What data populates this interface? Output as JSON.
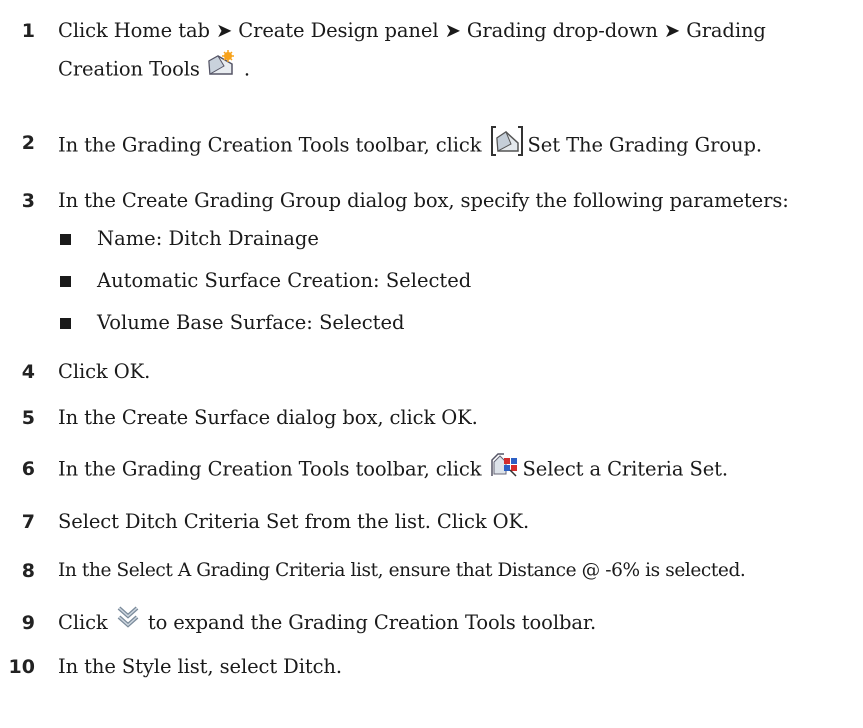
{
  "steps": [
    {
      "number": "1",
      "text_a": "Click Home tab ➤ Create Design panel ➤ Grading drop-down ➤ Grading",
      "text_b": "Creation Tools",
      "text_c": " .",
      "icon": "grading-creation-tools-icon"
    },
    {
      "number": "2",
      "text_a": "In the Grading Creation Tools toolbar, click ",
      "text_b": "Set The Grading Group.",
      "icon": "set-grading-group-icon"
    },
    {
      "number": "3",
      "text_a": "In the Create Grading Group dialog box, specify the following parameters:"
    },
    {
      "number": "4",
      "text_a": "Click OK."
    },
    {
      "number": "5",
      "text_a": "In the Create Surface dialog box, click OK."
    },
    {
      "number": "6",
      "text_a": "In the Grading Creation Tools toolbar, click ",
      "text_b": "Select a Criteria Set.",
      "icon": "select-criteria-set-icon"
    },
    {
      "number": "7",
      "text_a": "Select Ditch Criteria Set from the list. Click OK."
    },
    {
      "number": "8",
      "text_a": "In the Select A Grading Criteria list, ensure that Distance @ -6% is selected."
    },
    {
      "number": "9",
      "text_a": "Click ",
      "text_b": " to expand the Grading Creation Tools toolbar.",
      "icon": "expand-toolbar-chevron-icon"
    },
    {
      "number": "10",
      "text_a": "In the Style list, select Ditch."
    }
  ],
  "bullets": [
    "Name: Ditch Drainage",
    "Automatic Surface Creation: Selected",
    "Volume Base Surface: Selected"
  ]
}
